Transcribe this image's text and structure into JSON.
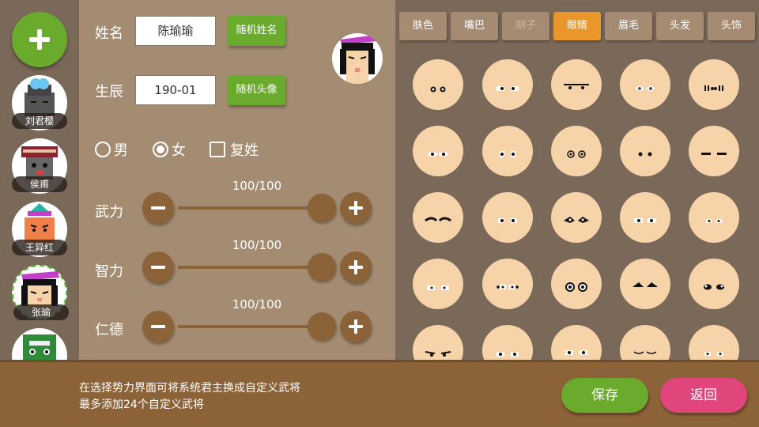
{
  "heroes": [
    {
      "name": "刘君樱",
      "selected": false
    },
    {
      "name": "侯甫",
      "selected": false
    },
    {
      "name": "王异红",
      "selected": false
    },
    {
      "name": "张瑜",
      "selected": true
    },
    {
      "name": "",
      "selected": false
    }
  ],
  "form": {
    "name_label": "姓名",
    "name_value": "陈瑜瑜",
    "random_name_btn": "随机姓名",
    "birth_label": "生辰",
    "birth_value": "190-01",
    "random_avatar_btn": "随机头像",
    "gender_male": "男",
    "gender_female": "女",
    "selected_gender": "女",
    "double_surname": "复姓",
    "double_surname_checked": false
  },
  "stats": [
    {
      "label": "武力",
      "value_text": "100/100",
      "value": 100,
      "max": 100
    },
    {
      "label": "智力",
      "value_text": "100/100",
      "value": 100,
      "max": 100
    },
    {
      "label": "仁德",
      "value_text": "100/100",
      "value": 100,
      "max": 100
    }
  ],
  "tabs": [
    {
      "label": "肤色",
      "state": "normal"
    },
    {
      "label": "嘴巴",
      "state": "normal"
    },
    {
      "label": "胡子",
      "state": "disabled"
    },
    {
      "label": "眼睛",
      "state": "active"
    },
    {
      "label": "眉毛",
      "state": "normal"
    },
    {
      "label": "头发",
      "state": "normal"
    },
    {
      "label": "头饰",
      "state": "normal"
    }
  ],
  "eye_options_count": 25,
  "footer": {
    "tip_line1": "在选择势力界面可将系统君主换成自定义武将",
    "tip_line2": "最多添加24个自定义武将",
    "save_btn": "保存",
    "back_btn": "返回"
  },
  "colors": {
    "accent_green": "#6aaa2c",
    "accent_orange": "#e9972a",
    "accent_pink": "#e0457c",
    "brown": "#8c6238"
  }
}
